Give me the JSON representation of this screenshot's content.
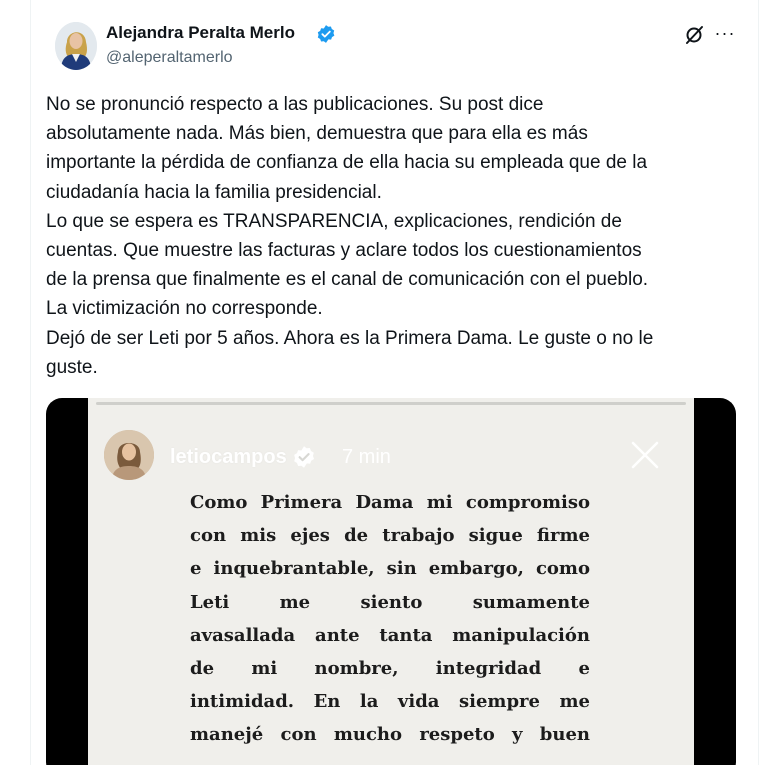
{
  "author": {
    "name": "Alejandra Peralta Merlo",
    "handle": "@aleperaltamerlo",
    "verified_icon": "verified-badge-icon",
    "accent_color": "#1d9bf0"
  },
  "actions": {
    "grok_icon": "grok-icon",
    "more_label": "···"
  },
  "tweet": {
    "paragraphs": [
      "No se pronunció respecto a las publicaciones. Su post dice\nabsolutamente nada. Más bien, demuestra que para ella es más\nimportante la pérdida de confianza de ella hacia su empleada que de la\nciudadanía hacia la familia presidencial.",
      "Lo que se espera es TRANSPARENCIA, explicaciones, rendición de\ncuentas. Que muestre las facturas y aclare todos los cuestionamientos\nde la prensa que finalmente es el canal de comunicación con el pueblo.",
      "La victimización no corresponde.",
      "Dejó de ser Leti por 5 años. Ahora es la Primera Dama. Le guste o no le\nguste."
    ]
  },
  "story": {
    "username": "letiocampos",
    "time": "7 min",
    "close_icon": "close-icon",
    "lines": [
      "Como Primera Dama mi compromiso",
      "con mis ejes de trabajo sigue firme",
      "e inquebrantable, sin embargo, como",
      "Leti me siento sumamente",
      "avasallada ante tanta manipulación",
      "de mi nombre, integridad e",
      "intimidad. En la vida siempre me",
      "manejé con mucho respeto y buen"
    ]
  }
}
